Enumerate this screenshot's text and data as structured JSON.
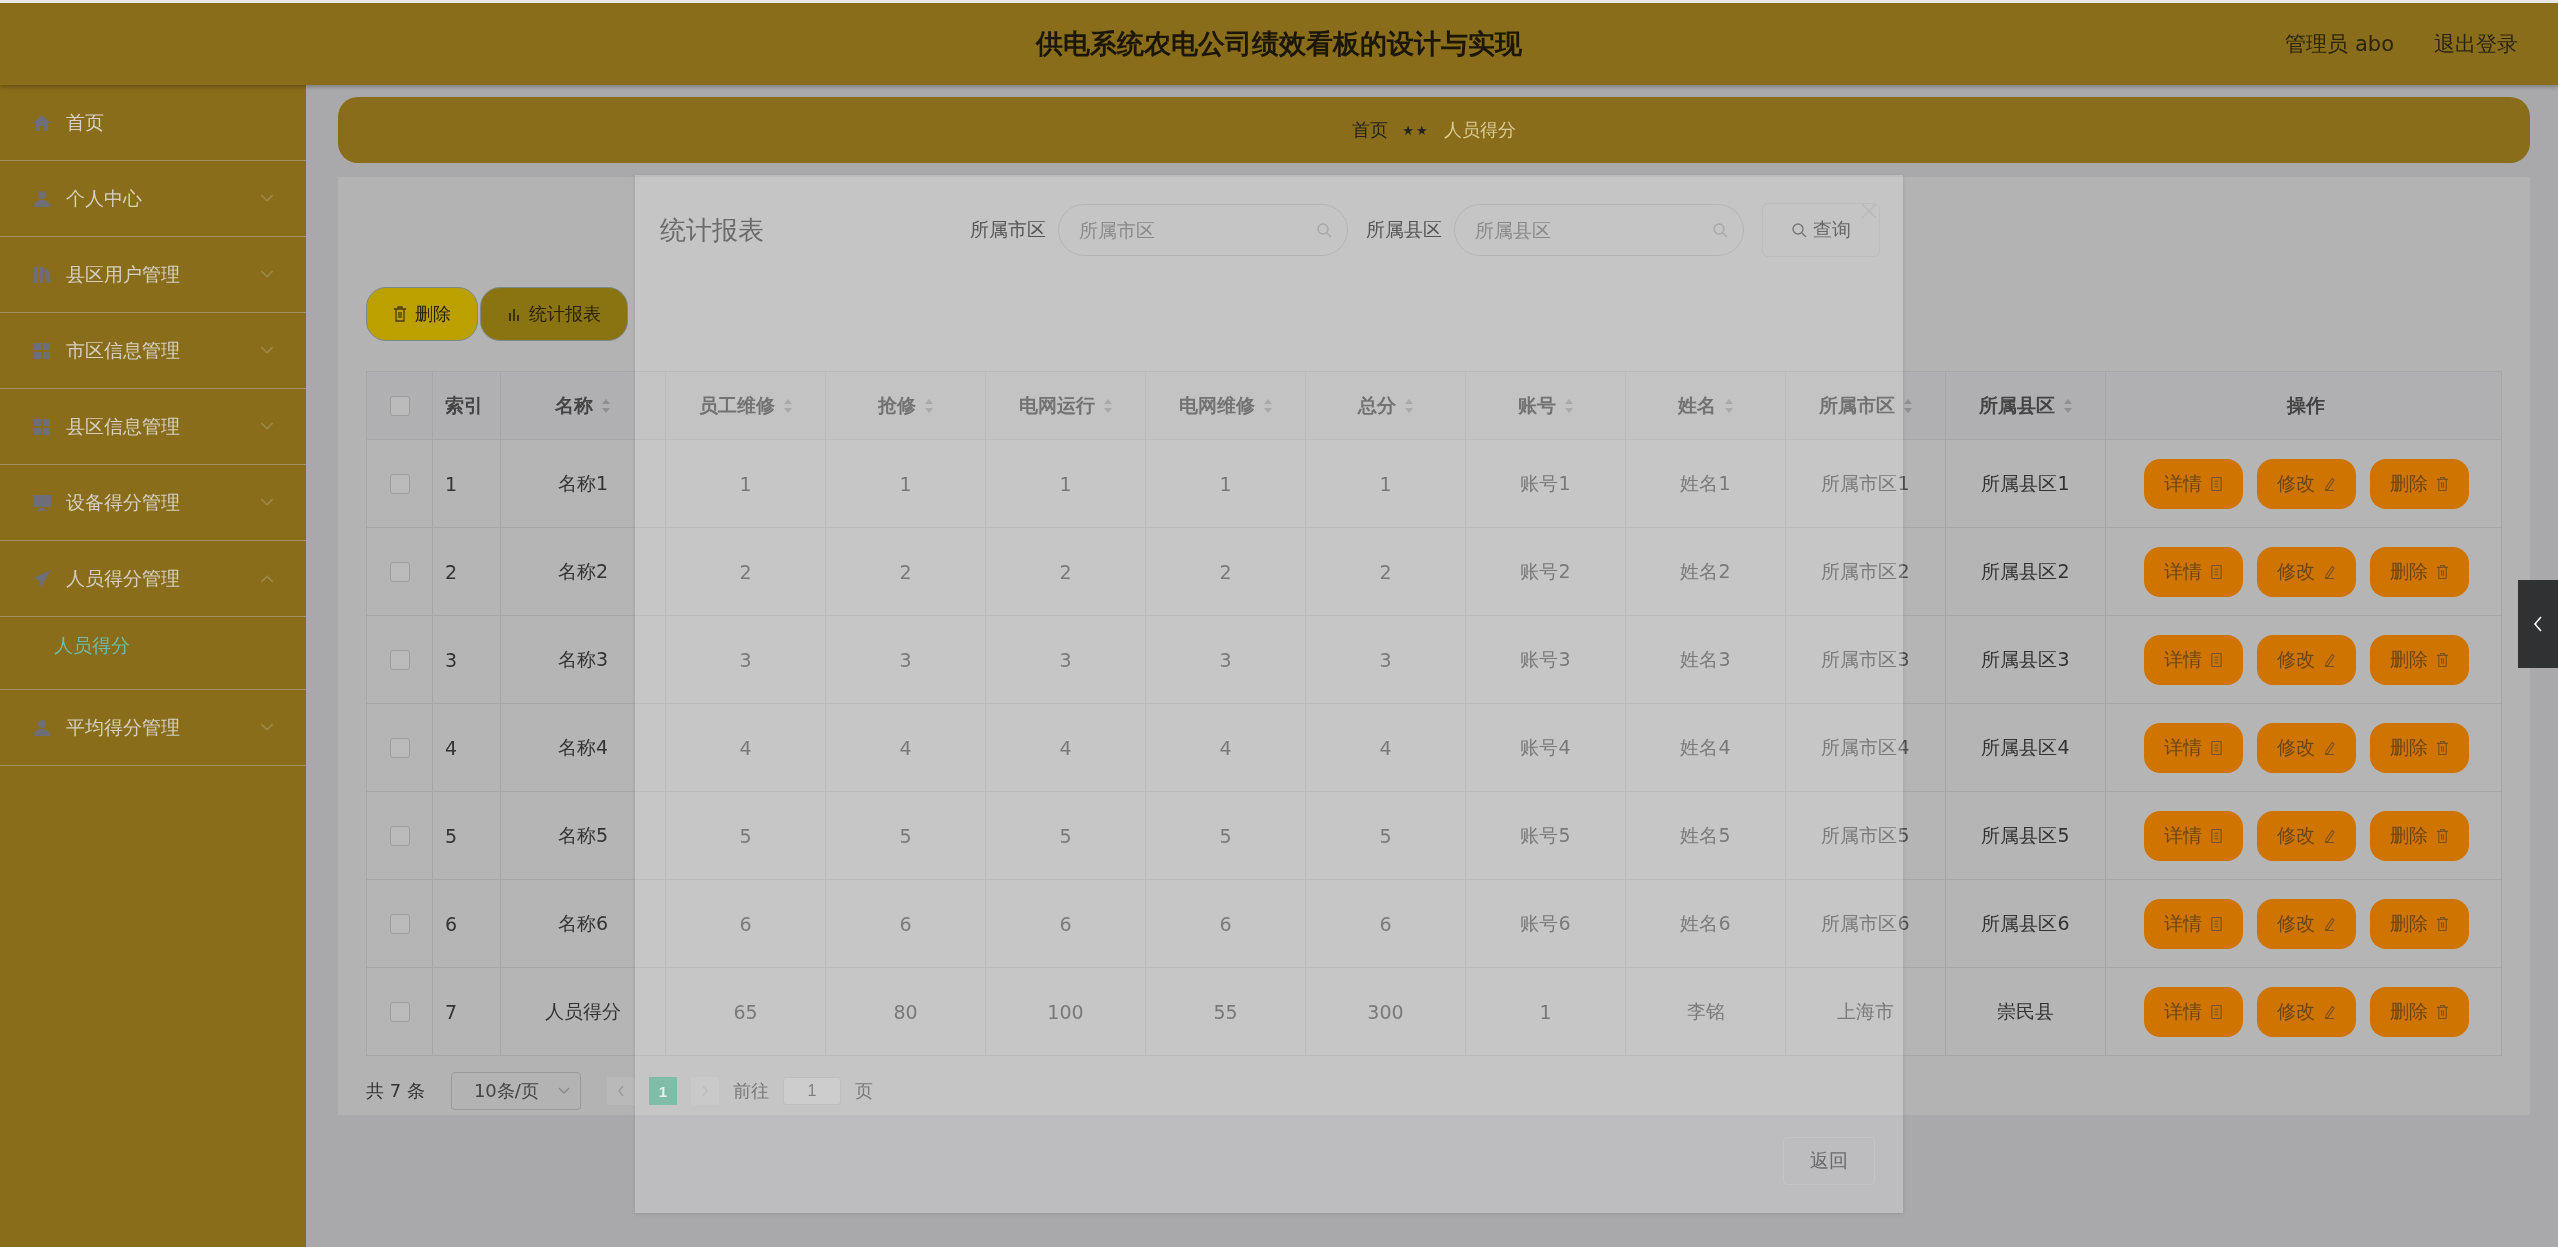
{
  "header": {
    "title": "供电系统农电公司绩效看板的设计与实现",
    "user": "管理员 abo",
    "logout": "退出登录"
  },
  "sidebar": {
    "items": [
      {
        "label": "首页"
      },
      {
        "label": "个人中心",
        "expanded": false
      },
      {
        "label": "县区用户管理",
        "expanded": false
      },
      {
        "label": "市区信息管理",
        "expanded": false
      },
      {
        "label": "县区信息管理",
        "expanded": false
      },
      {
        "label": "设备得分管理",
        "expanded": false
      },
      {
        "label": "人员得分管理",
        "expanded": true,
        "children": [
          {
            "label": "人员得分",
            "selected": true
          }
        ]
      },
      {
        "label": "平均得分管理",
        "expanded": false
      }
    ]
  },
  "breadcrumb": {
    "items": [
      "首页",
      "人员得分"
    ],
    "separator": "★★"
  },
  "toolbar": [
    {
      "label": "删除",
      "kind": "delete"
    },
    {
      "label": "统计报表",
      "kind": "report"
    }
  ],
  "table": {
    "select_all_checked": false,
    "columns": [
      {
        "label": "索引",
        "sortable": false
      },
      {
        "label": "名称",
        "sortable": true
      },
      {
        "label": "员工维修",
        "sortable": true
      },
      {
        "label": "抢修",
        "sortable": true
      },
      {
        "label": "电网运行",
        "sortable": true
      },
      {
        "label": "电网维修",
        "sortable": true
      },
      {
        "label": "总分",
        "sortable": true
      },
      {
        "label": "账号",
        "sortable": true
      },
      {
        "label": "姓名",
        "sortable": true
      },
      {
        "label": "所属市区",
        "sortable": true
      },
      {
        "label": "所属县区",
        "sortable": true
      },
      {
        "label": "操作",
        "sortable": false
      }
    ],
    "rows": [
      {
        "checked": false,
        "cells": [
          "1",
          "名称1",
          "1",
          "1",
          "1",
          "1",
          "1",
          "账号1",
          "姓名1",
          "所属市区1",
          "所属县区1"
        ],
        "actions": [
          {
            "label": "详情",
            "kind": "detail"
          },
          {
            "label": "修改",
            "kind": "edit"
          },
          {
            "label": "删除",
            "kind": "delete"
          }
        ]
      },
      {
        "checked": false,
        "cells": [
          "2",
          "名称2",
          "2",
          "2",
          "2",
          "2",
          "2",
          "账号2",
          "姓名2",
          "所属市区2",
          "所属县区2"
        ],
        "actions": [
          {
            "label": "详情",
            "kind": "detail"
          },
          {
            "label": "修改",
            "kind": "edit"
          },
          {
            "label": "删除",
            "kind": "delete"
          }
        ]
      },
      {
        "checked": false,
        "cells": [
          "3",
          "名称3",
          "3",
          "3",
          "3",
          "3",
          "3",
          "账号3",
          "姓名3",
          "所属市区3",
          "所属县区3"
        ],
        "actions": [
          {
            "label": "详情",
            "kind": "detail"
          },
          {
            "label": "修改",
            "kind": "edit"
          },
          {
            "label": "删除",
            "kind": "delete"
          }
        ]
      },
      {
        "checked": false,
        "cells": [
          "4",
          "名称4",
          "4",
          "4",
          "4",
          "4",
          "4",
          "账号4",
          "姓名4",
          "所属市区4",
          "所属县区4"
        ],
        "actions": [
          {
            "label": "详情",
            "kind": "detail"
          },
          {
            "label": "修改",
            "kind": "edit"
          },
          {
            "label": "删除",
            "kind": "delete"
          }
        ]
      },
      {
        "checked": false,
        "cells": [
          "5",
          "名称5",
          "5",
          "5",
          "5",
          "5",
          "5",
          "账号5",
          "姓名5",
          "所属市区5",
          "所属县区5"
        ],
        "actions": [
          {
            "label": "详情",
            "kind": "detail"
          },
          {
            "label": "修改",
            "kind": "edit"
          },
          {
            "label": "删除",
            "kind": "delete"
          }
        ]
      },
      {
        "checked": false,
        "cells": [
          "6",
          "名称6",
          "6",
          "6",
          "6",
          "6",
          "6",
          "账号6",
          "姓名6",
          "所属市区6",
          "所属县区6"
        ],
        "actions": [
          {
            "label": "详情",
            "kind": "detail"
          },
          {
            "label": "修改",
            "kind": "edit"
          },
          {
            "label": "删除",
            "kind": "delete"
          }
        ]
      },
      {
        "checked": false,
        "cells": [
          "7",
          "人员得分",
          "65",
          "80",
          "100",
          "55",
          "300",
          "1",
          "李铭",
          "上海市",
          "崇民县"
        ],
        "actions": [
          {
            "label": "详情",
            "kind": "detail"
          },
          {
            "label": "修改",
            "kind": "edit"
          },
          {
            "label": "删除",
            "kind": "delete"
          }
        ]
      }
    ]
  },
  "pagination": {
    "total": "共 7 条",
    "page_size": "10条/页",
    "pages": [
      {
        "label": "1",
        "selected": true
      }
    ],
    "goto_label": "前往",
    "goto_value": "1",
    "goto_suffix": "页"
  },
  "dialog": {
    "title": "统计报表",
    "filters": [
      {
        "label": "所属市区",
        "placeholder": "所属市区"
      },
      {
        "label": "所属县区",
        "placeholder": "所属县区"
      }
    ],
    "search_button": "查询",
    "back_button": "返回"
  }
}
